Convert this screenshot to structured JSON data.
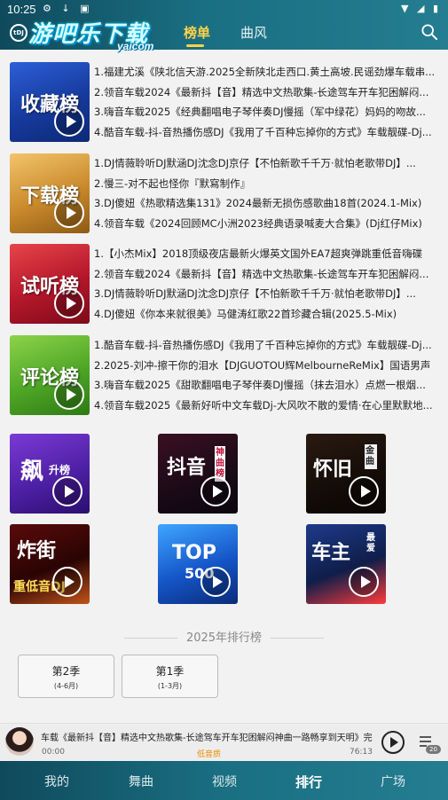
{
  "status_bar": {
    "time": "10:25"
  },
  "header": {
    "badge": "tDJ",
    "logo_text": "游吧乐下载",
    "logo_sub": "yaicom",
    "tabs": [
      {
        "label": "榜单",
        "active": true
      },
      {
        "label": "曲风",
        "active": false
      }
    ],
    "accent_color": "#ffd24a"
  },
  "rankings": [
    {
      "cover_title": "收藏榜",
      "lines": [
        "1.福建尤溪《陕北信天游.2025全新陕北走西口.黄土高坡.民谣劲爆车载串...",
        "2.领音车载2024《最新抖【音】精选中文热歌集-长途驾车开车犯困解闷...",
        "3.嗨音车载2025《经典翻唱电子琴伴奏DJ慢摇（军中绿花）妈妈的吻故...",
        "4.酷音车载-抖-音热播伤感DJ《我用了千百种忘掉你的方式》车载靓碟-Dj..."
      ]
    },
    {
      "cover_title": "下载榜",
      "lines": [
        "1.DJ情薇聆听DJ默涵DJ沈念DJ京仔【不怕新歌千千万·就怕老歌带DJ】...",
        "2.慢三-对不起也怪你『默寫制作』",
        "3.DJ傻妞《热歌精选集131》2024最新无损伤感歌曲18首(2024.1-Mix)",
        "4.领音车载《2024回顾MC小洲2023经典语录喊麦大合集》(Dj红仔Mix)"
      ]
    },
    {
      "cover_title": "试听榜",
      "lines": [
        "1.【小杰Mix】2018顶级夜店最新火爆英文国外EA7超爽弹跳重低音嗨碟",
        "2.领音车载2024《最新抖【音】精选中文热歌集-长途驾车开车犯困解闷...",
        "3.DJ情薇聆听DJ默涵DJ沈念DJ京仔【不怕新歌千千万·就怕老歌带DJ】...",
        "4.DJ傻妞《你本来就很美》马健涛红歌22首珍藏合辑(2025.5-Mix)"
      ]
    },
    {
      "cover_title": "评论榜",
      "lines": [
        "1.酷音车载-抖-音热播伤感DJ《我用了千百种忘掉你的方式》车载靓碟-Dj...",
        "2.2025-刘冲-擦干你的泪水【DJGUOTOU辉MelbourneReMix】国语男声",
        "3.嗨音车载2025《甜歌翻唱电子琴伴奏DJ慢摇（抹去泪水）点燃一根烟...",
        "4.领音车载2025《最新好听中文车载Dj-大风吹不散的爱情·在心里默默地..."
      ]
    }
  ],
  "grid": [
    {
      "label": "飙",
      "sub": "升榜"
    },
    {
      "label": "抖音",
      "sub": "神曲榜"
    },
    {
      "label": "怀旧",
      "sub": "金曲"
    },
    {
      "label": "炸街",
      "sub": "重低音DJ"
    },
    {
      "label": "TOP",
      "sub": "500"
    },
    {
      "label": "车主",
      "sub": "最爱"
    }
  ],
  "section_title": "2025年排行榜",
  "seasons": [
    {
      "name": "第2季",
      "range": "(4-6月)"
    },
    {
      "name": "第1季",
      "range": "(1-3月)"
    }
  ],
  "player": {
    "title": "车载《最新抖【音】精选中文热歌集-长途驾车开车犯困解闷神曲一路畅享到天明》完",
    "start_time": "00:00",
    "quality": "低音质",
    "end_time": "76:13",
    "queue_count": "20"
  },
  "bottom_nav": [
    {
      "label": "我的",
      "active": false
    },
    {
      "label": "舞曲",
      "active": false
    },
    {
      "label": "视频",
      "active": false
    },
    {
      "label": "排行",
      "active": true
    },
    {
      "label": "广场",
      "active": false
    }
  ]
}
